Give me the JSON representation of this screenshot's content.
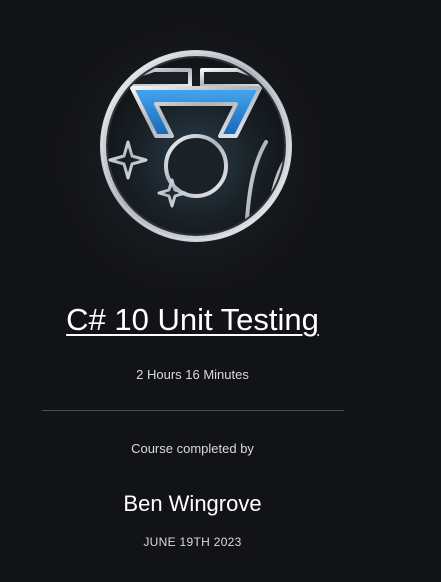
{
  "certificate": {
    "badge_icon": "medal-badge-icon",
    "course_title": "C# 10 Unit Testing",
    "duration": "2 Hours 16 Minutes",
    "completed_by_label": "Course completed by",
    "learner_name": "Ben Wingrove",
    "completion_date": "JUNE 19TH 2023"
  },
  "colors": {
    "background": "#121317",
    "badge_blue": "#1f86d8",
    "badge_silver": "#c9ced6",
    "text_primary": "#ffffff",
    "text_secondary": "#d9dadd",
    "divider": "#4a4d55"
  }
}
